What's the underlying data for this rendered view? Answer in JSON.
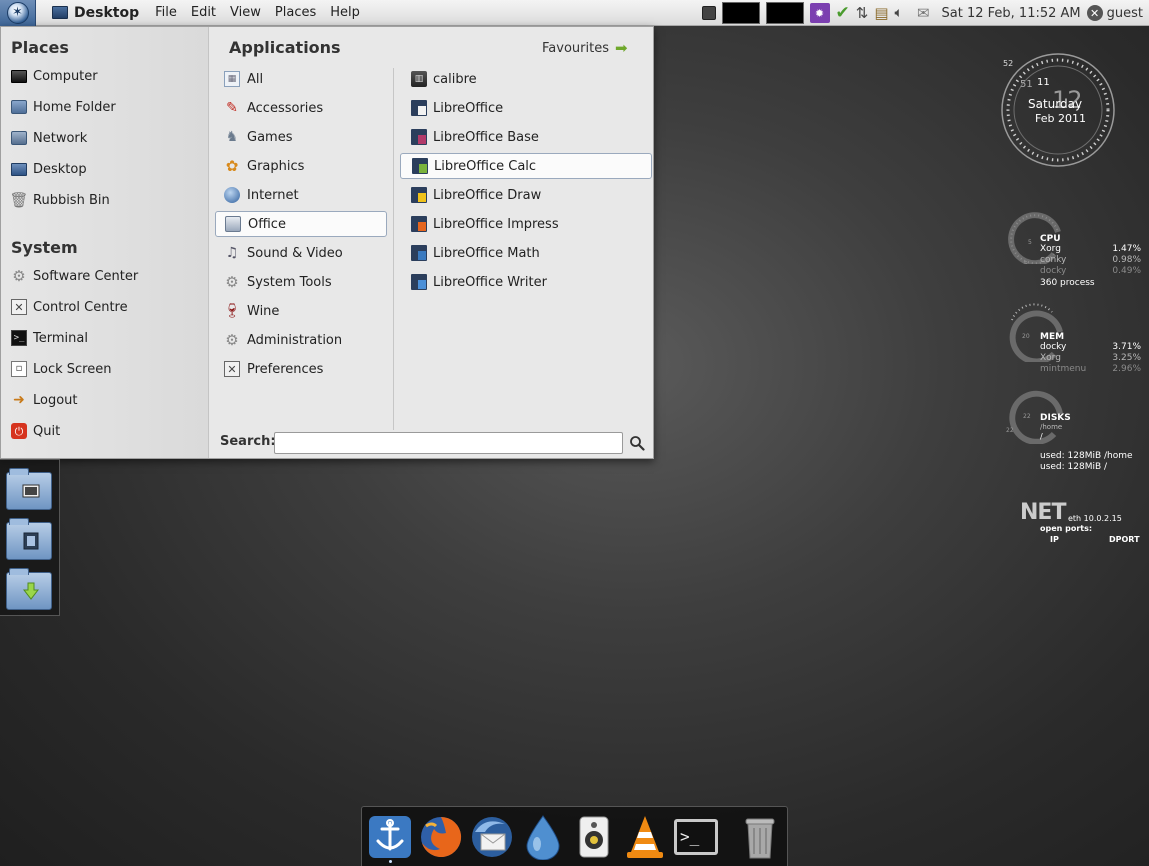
{
  "top_panel": {
    "app_name": "Desktop",
    "menus": [
      "File",
      "Edit",
      "View",
      "Places",
      "Help"
    ],
    "clock": "Sat 12 Feb, 11:52 AM",
    "user": "guest"
  },
  "menu": {
    "places_heading": "Places",
    "places": [
      {
        "label": "Computer",
        "icon": "computer-icon"
      },
      {
        "label": "Home Folder",
        "icon": "home-folder-icon"
      },
      {
        "label": "Network",
        "icon": "network-icon"
      },
      {
        "label": "Desktop",
        "icon": "desktop-icon"
      },
      {
        "label": "Rubbish Bin",
        "icon": "trash-icon"
      }
    ],
    "system_heading": "System",
    "system": [
      {
        "label": "Software Center",
        "icon": "software-center-icon"
      },
      {
        "label": "Control Centre",
        "icon": "control-centre-icon"
      },
      {
        "label": "Terminal",
        "icon": "terminal-icon"
      },
      {
        "label": "Lock Screen",
        "icon": "lock-icon"
      },
      {
        "label": "Logout",
        "icon": "logout-icon"
      },
      {
        "label": "Quit",
        "icon": "power-icon"
      }
    ],
    "applications_heading": "Applications",
    "favourites_label": "Favourites",
    "categories": [
      {
        "label": "All",
        "icon": "all-apps-icon"
      },
      {
        "label": "Accessories",
        "icon": "accessories-icon"
      },
      {
        "label": "Games",
        "icon": "games-icon"
      },
      {
        "label": "Graphics",
        "icon": "graphics-icon"
      },
      {
        "label": "Internet",
        "icon": "globe-icon"
      },
      {
        "label": "Office",
        "icon": "office-icon"
      },
      {
        "label": "Sound & Video",
        "icon": "sound-video-icon"
      },
      {
        "label": "System Tools",
        "icon": "system-tools-icon"
      },
      {
        "label": "Wine",
        "icon": "wine-glass-icon"
      },
      {
        "label": "Administration",
        "icon": "administration-icon"
      },
      {
        "label": "Preferences",
        "icon": "preferences-icon"
      }
    ],
    "selected_category": "Office",
    "apps": [
      {
        "label": "calibre",
        "icon": "calibre-icon"
      },
      {
        "label": "LibreOffice",
        "icon": "libreoffice-icon"
      },
      {
        "label": "LibreOffice Base",
        "icon": "libreoffice-base-icon"
      },
      {
        "label": "LibreOffice Calc",
        "icon": "libreoffice-calc-icon"
      },
      {
        "label": "LibreOffice Draw",
        "icon": "libreoffice-draw-icon"
      },
      {
        "label": "LibreOffice Impress",
        "icon": "libreoffice-impress-icon"
      },
      {
        "label": "LibreOffice Math",
        "icon": "libreoffice-math-icon"
      },
      {
        "label": "LibreOffice Writer",
        "icon": "libreoffice-writer-icon"
      }
    ],
    "highlighted_app": "LibreOffice Calc",
    "search_label": "Search:",
    "search_value": ""
  },
  "conky": {
    "clock": {
      "seconds": "52",
      "hour_label": "11",
      "minute_label": "51",
      "day_number": "12",
      "weekday": "Saturday",
      "month_year": "Feb 2011"
    },
    "cpu": {
      "title": "CPU",
      "processes": [
        {
          "name": "Xorg",
          "value": "1.47%"
        },
        {
          "name": "conky",
          "value": "0.98%"
        },
        {
          "name": "docky",
          "value": "0.49%"
        }
      ],
      "process_count": "360 process",
      "gauge_labels": [
        "5",
        "5"
      ]
    },
    "mem": {
      "title": "MEM",
      "processes": [
        {
          "name": "docky",
          "value": "3.71%"
        },
        {
          "name": "Xorg",
          "value": "3.25%"
        },
        {
          "name": "mintmenu",
          "value": "2.96%"
        }
      ],
      "gauge_label": "20"
    },
    "disks": {
      "title": "DISKS",
      "mount": "/home",
      "root": "/",
      "gauge_labels": [
        "22",
        "22"
      ],
      "used_home": "used: 128MiB /home",
      "used_root": "used: 128MiB /"
    },
    "net": {
      "title": "NET",
      "interface": "eth 10.0.2.15",
      "open_ports": "open ports:",
      "col_ip": "IP",
      "col_dport": "DPORT"
    }
  },
  "side_folders": [
    {
      "icon": "pictures-folder-icon"
    },
    {
      "icon": "videos-folder-icon"
    },
    {
      "icon": "downloads-folder-icon"
    }
  ],
  "dock": [
    {
      "icon": "anchor-icon"
    },
    {
      "icon": "firefox-icon"
    },
    {
      "icon": "thunderbird-icon"
    },
    {
      "icon": "water-drop-icon"
    },
    {
      "icon": "speaker-icon"
    },
    {
      "icon": "vlc-cone-icon"
    },
    {
      "icon": "terminal-icon"
    },
    {
      "icon": "trash-can-icon"
    }
  ],
  "colors": {
    "accent": "#3d6597",
    "menu_bg": "#e8e8e8",
    "desktop_bg": "#3e3e3e",
    "favourites_arrow": "#6fa82b"
  }
}
